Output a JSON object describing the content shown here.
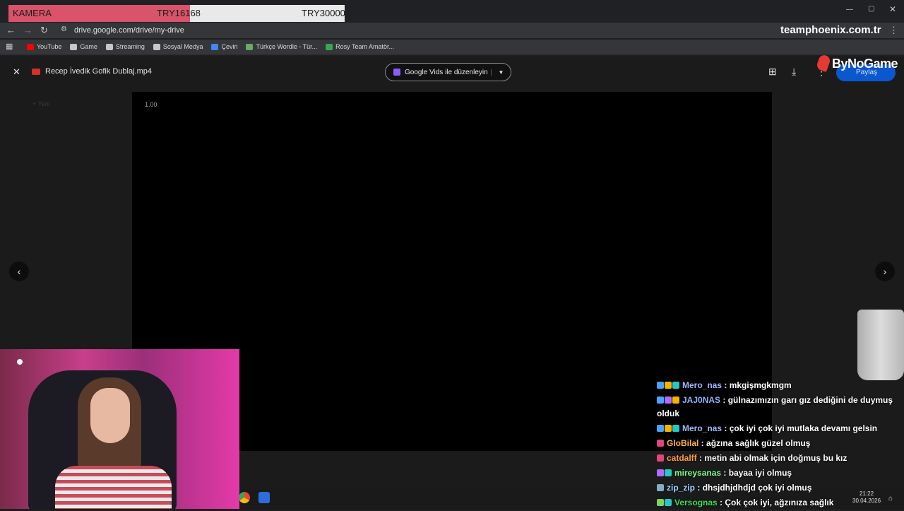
{
  "overlay": {
    "goal_label": "KAMERA",
    "goal_current": "TRY16168",
    "goal_target": "TRY30000",
    "goal_progress": 0.539,
    "brand_site": "teamphoenix.com.tr",
    "brand_logo": "ByNoGame"
  },
  "browser": {
    "url": "drive.google.com/drive/my-drive",
    "bookmarks": [
      {
        "label": "YouTube",
        "icon": "youtube-icon",
        "color": "#ff0000"
      },
      {
        "label": "Game",
        "icon": "folder-icon",
        "color": "#c7c7c7"
      },
      {
        "label": "Streaming",
        "icon": "folder-icon",
        "color": "#c7c7c7"
      },
      {
        "label": "Sosyal Medya",
        "icon": "folder-icon",
        "color": "#c7c7c7"
      },
      {
        "label": "Çeviri",
        "icon": "translate-icon",
        "color": "#4285f4"
      },
      {
        "label": "Türkçe Wordle - Tür...",
        "icon": "wordle-icon",
        "color": "#6aaa64"
      },
      {
        "label": "Rosy Team Amatör...",
        "icon": "drive-icon",
        "color": "#34a853"
      }
    ]
  },
  "viewer": {
    "file_name": "Recep İvedik Gofik Dublaj.mp4",
    "edit_button": "Google Vids ile düzenleyin",
    "share_button": "Paylaş",
    "playback_speed": "1.00"
  },
  "chat": [
    {
      "user": "Mero_nas",
      "text": "mkgişmgkmgm",
      "color": "#9fb8ff",
      "badges": [
        "#4aa3ff",
        "#f2b400",
        "#29c6c6"
      ]
    },
    {
      "user": "JAJ0NAS",
      "text": "gülnazımızın garı gız dediğini de duymuş olduk",
      "color": "#8fb3ff",
      "badges": [
        "#4aa3ff",
        "#b06cff",
        "#f2b400"
      ]
    },
    {
      "user": "Mero_nas",
      "text": "çok iyi çok iyi mutlaka devamı gelsin",
      "color": "#9fb8ff",
      "badges": [
        "#4aa3ff",
        "#f2b400",
        "#29c6c6"
      ]
    },
    {
      "user": "GloBilal",
      "text": "ağzına sağlık güzel olmuş",
      "color": "#ffb347",
      "badges": [
        "#e0457b"
      ]
    },
    {
      "user": "catdalff",
      "text": "metin abi olmak için doğmuş bu kız",
      "color": "#ff9f43",
      "badges": [
        "#e0457b"
      ]
    },
    {
      "user": "mireysanas",
      "text": "bayaa iyi olmuş",
      "color": "#7dff8a",
      "badges": [
        "#b06cff",
        "#29c6c6"
      ]
    },
    {
      "user": "zip_zip",
      "text": "dhsjdhjdhdjd çok iyi olmuş",
      "color": "#9fd3ff",
      "badges": [
        "#7fb0c0"
      ]
    },
    {
      "user": "Versognas",
      "text": "Çok çok iyi, ağzınıza sağlık",
      "color": "#3cdc5a",
      "badges": [
        "#7fd35b",
        "#29c6c6"
      ]
    }
  ],
  "taskbar": {
    "time": "21:22",
    "date": "30.04.2026"
  }
}
